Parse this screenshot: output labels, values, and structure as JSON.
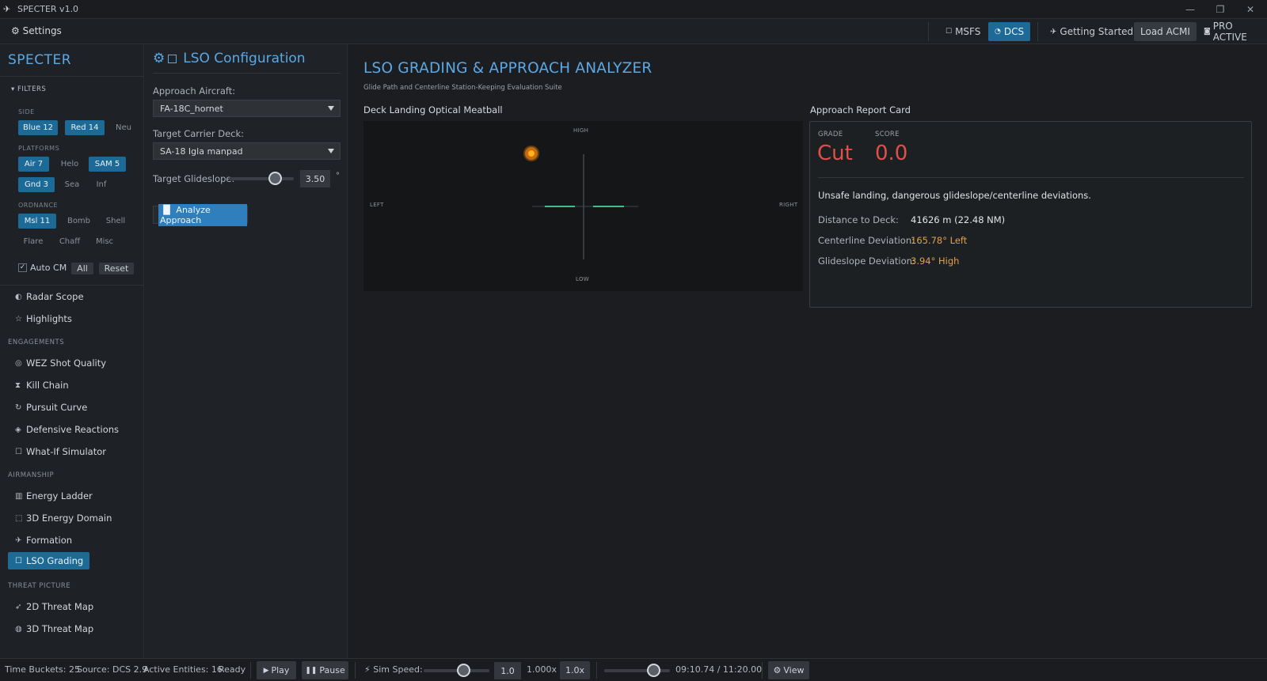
{
  "window": {
    "title": "SPECTER v1.0"
  },
  "toolbar": {
    "settings_label": "Settings",
    "msfs_label": "MSFS",
    "dcs_label": "DCS",
    "getting_started_label": "Getting Started",
    "load_acmi_label": "Load ACMI",
    "pro_label": "PRO ACTIVE"
  },
  "sidebar": {
    "brand": "SPECTER",
    "filters_label": "FILTERS",
    "side_label": "SIDE",
    "side_chips": [
      {
        "label": "Blue 12",
        "on": true
      },
      {
        "label": "Red 14",
        "on": true
      },
      {
        "label": "Neu",
        "on": false
      }
    ],
    "platforms_label": "PLATFORMS",
    "platform_chips": [
      {
        "label": "Air 7",
        "on": true
      },
      {
        "label": "Helo",
        "on": false
      },
      {
        "label": "SAM 5",
        "on": true
      },
      {
        "label": "Gnd 3",
        "on": true
      },
      {
        "label": "Sea",
        "on": false
      },
      {
        "label": "Inf",
        "on": false
      }
    ],
    "ordnance_label": "ORDNANCE",
    "ordnance_chips": [
      {
        "label": "Msl 11",
        "on": true
      },
      {
        "label": "Bomb",
        "on": false
      },
      {
        "label": "Shell",
        "on": false
      },
      {
        "label": "Flare",
        "on": false
      },
      {
        "label": "Chaff",
        "on": false
      },
      {
        "label": "Misc",
        "on": false
      }
    ],
    "auto_cm_label": "Auto CM",
    "auto_cm_checked": true,
    "all_label": "All",
    "reset_label": "Reset",
    "top_items": [
      {
        "label": "Radar Scope",
        "icon": "radar-icon"
      },
      {
        "label": "Highlights",
        "icon": "star-icon"
      }
    ],
    "engagements_label": "ENGAGEMENTS",
    "engagement_items": [
      {
        "label": "WEZ Shot Quality",
        "icon": "target-icon"
      },
      {
        "label": "Kill Chain",
        "icon": "hourglass-icon"
      },
      {
        "label": "Pursuit Curve",
        "icon": "loop-icon"
      },
      {
        "label": "Defensive Reactions",
        "icon": "shield-icon"
      },
      {
        "label": "What-If Simulator",
        "icon": "square-icon"
      }
    ],
    "airmanship_label": "AIRMANSHIP",
    "airmanship_items": [
      {
        "label": "Energy Ladder",
        "icon": "bars-icon"
      },
      {
        "label": "3D Energy Domain",
        "icon": "cube-icon"
      },
      {
        "label": "Formation",
        "icon": "plane-icon"
      },
      {
        "label": "LSO Grading",
        "icon": "square-icon",
        "active": true
      }
    ],
    "threat_label": "THREAT PICTURE",
    "threat_items": [
      {
        "label": "2D Threat Map",
        "icon": "pin-icon"
      },
      {
        "label": "3D Threat Map",
        "icon": "globe-icon"
      }
    ]
  },
  "config": {
    "title": "LSO Configuration",
    "aircraft_label": "Approach Aircraft:",
    "aircraft_value": "FA-18C_hornet",
    "deck_label": "Target Carrier Deck:",
    "deck_value": "SA-18 Igla manpad",
    "glideslope_label": "Target Glideslope:",
    "glideslope_value": "3.50",
    "glideslope_unit": "°",
    "analyze_label": "Analyze Approach"
  },
  "main": {
    "title": "LSO GRADING & APPROACH ANALYZER",
    "subtitle": "Glide Path and Centerline Station-Keeping Evaluation Suite",
    "meatball_title": "Deck Landing Optical Meatball",
    "meatball_labels": {
      "high": "HIGH",
      "low": "LOW",
      "left": "LEFT",
      "right": "RIGHT"
    },
    "report_title": "Approach Report Card",
    "grade_label": "GRADE",
    "grade_value": "Cut",
    "score_label": "SCORE",
    "score_value": "0.0",
    "message": "Unsafe landing, dangerous glideslope/centerline deviations.",
    "rows": [
      {
        "key": "Distance to Deck:",
        "value": "41626 m (22.48 NM)",
        "warn": false
      },
      {
        "key": "Centerline Deviation:",
        "value": "165.78° Left",
        "warn": true
      },
      {
        "key": "Glideslope Deviation:",
        "value": "3.94° High",
        "warn": true
      }
    ]
  },
  "status": {
    "time_buckets": "Time Buckets: 25",
    "source": "Source: DCS 2.9",
    "entities": "Active Entities: 16",
    "ready": "Ready",
    "play_label": "Play",
    "pause_label": "Pause",
    "sim_speed_label": "Sim Speed:",
    "speed_box": "1.0",
    "speed_mult": "1.000x",
    "speed_btn": "1.0x",
    "timecode": "09:10.74 / 11:20.00",
    "view_label": "View"
  },
  "colors": {
    "accent": "#5aa9e6",
    "active": "#1e6a96",
    "danger": "#e0504a",
    "warn": "#e2a04a",
    "ball": "#f08a10",
    "datum": "#3fbf8c"
  }
}
